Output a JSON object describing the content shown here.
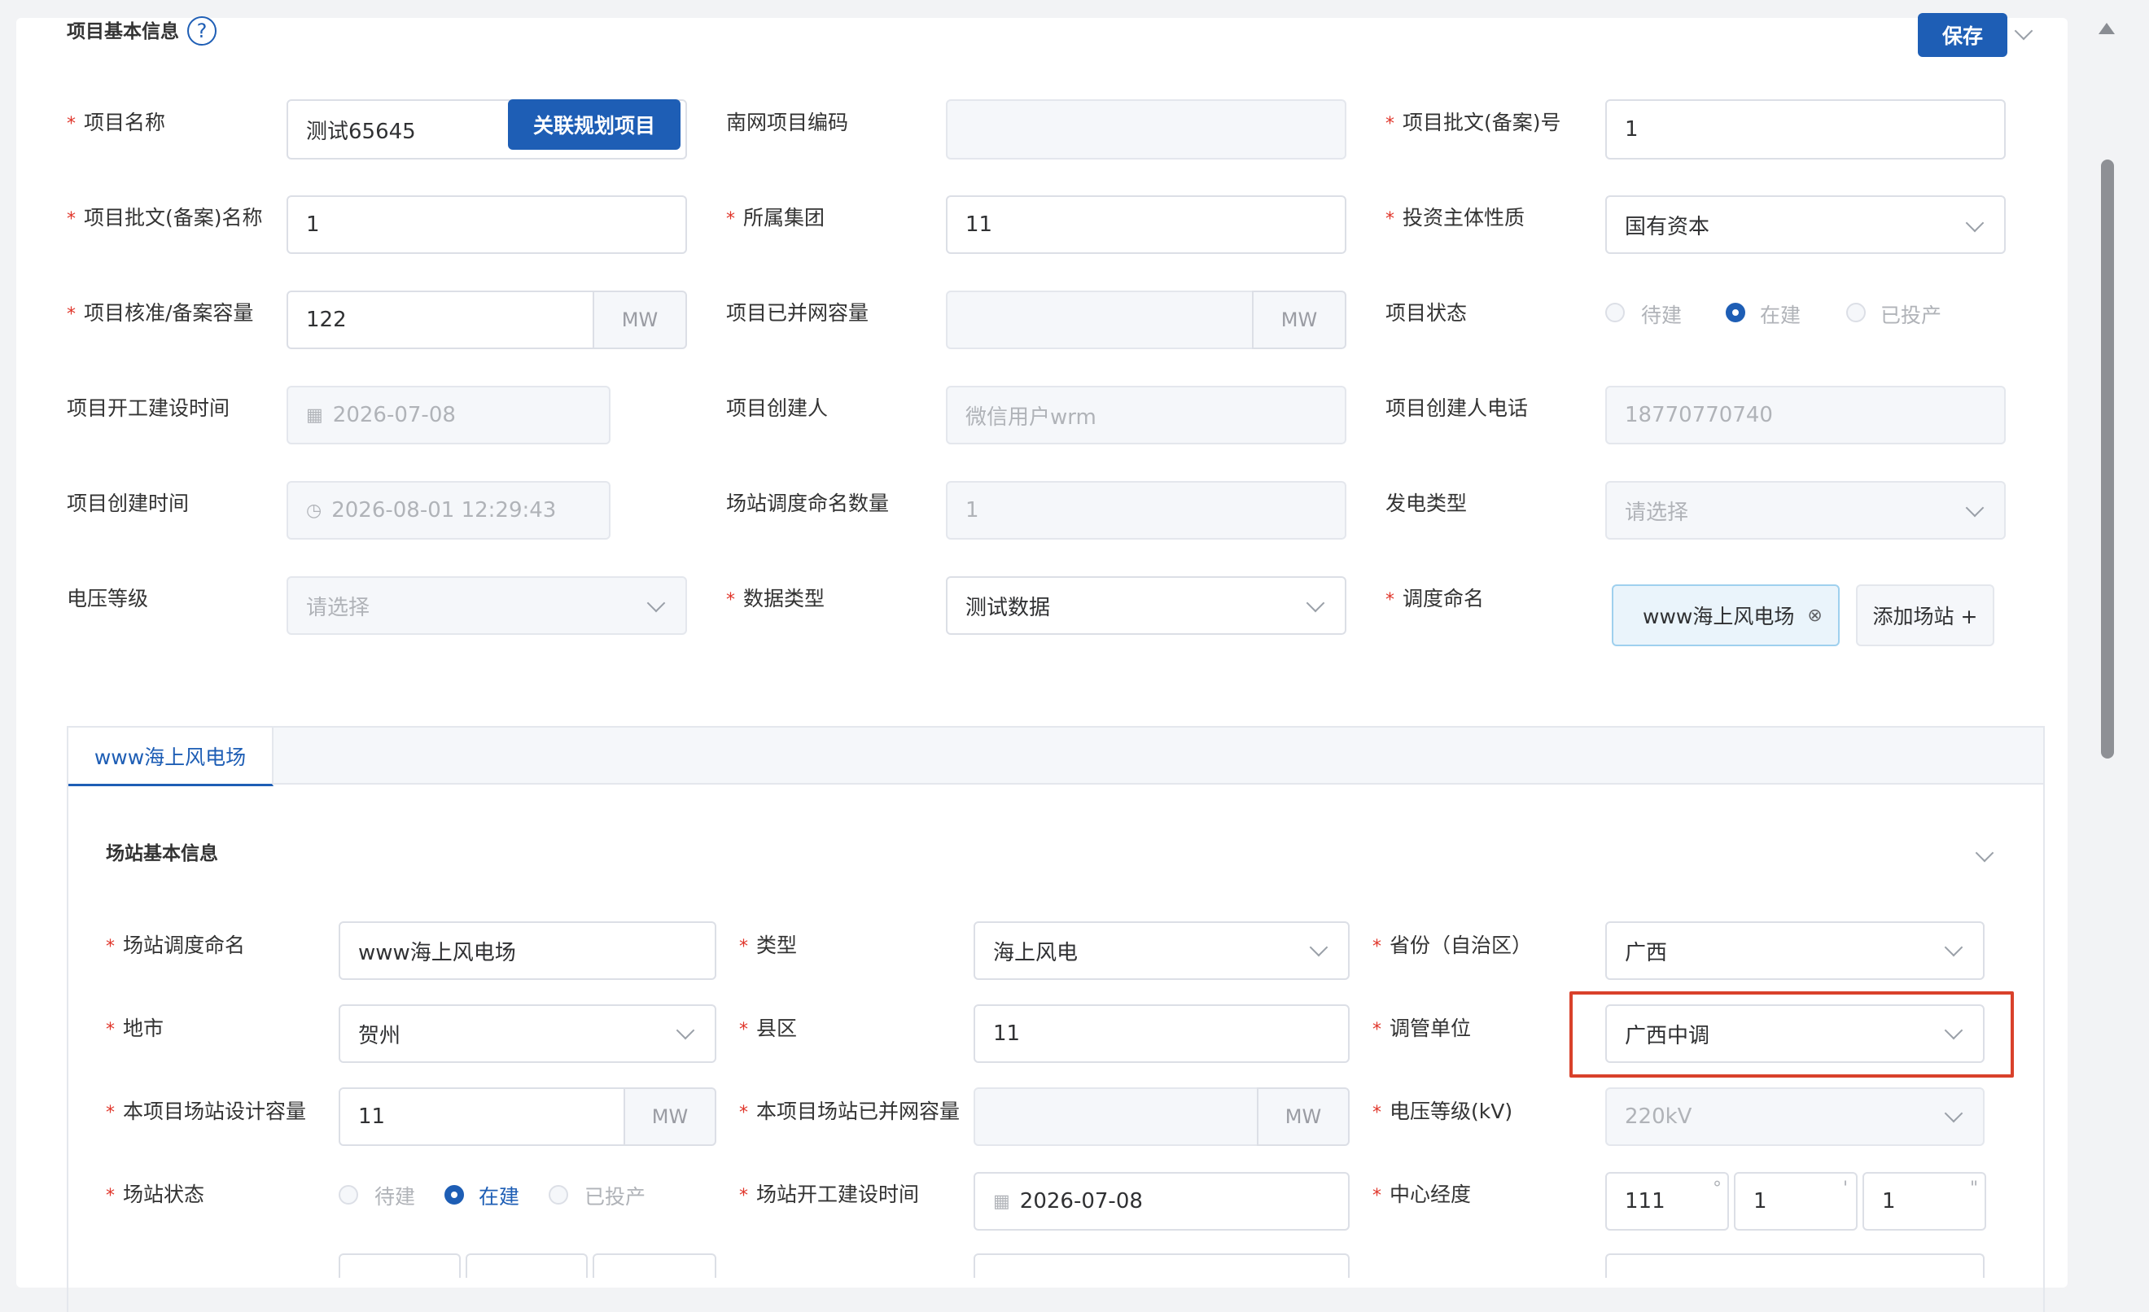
{
  "header": {
    "section_title": "项目基本信息",
    "save_label": "保存"
  },
  "project": {
    "name_label": "项目名称",
    "name_value": "测试65645",
    "link_button": "关联规划项目",
    "nanwang_code_label": "南网项目编码",
    "nanwang_code_value": "",
    "approval_no_label": "项目批文(备案)号",
    "approval_no_value": "1",
    "approval_name_label": "项目批文(备案)名称",
    "approval_name_value": "1",
    "group_label": "所属集团",
    "group_value": "11",
    "invest_label": "投资主体性质",
    "invest_value": "国有资本",
    "capacity_label": "项目核准/备案容量",
    "capacity_value": "122",
    "capacity_unit": "MW",
    "grid_capacity_label": "项目已并网容量",
    "grid_capacity_value": "",
    "grid_capacity_unit": "MW",
    "status_label": "项目状态",
    "status_options": [
      "待建",
      "在建",
      "已投产"
    ],
    "status_selected": "在建",
    "start_time_label": "项目开工建设时间",
    "start_time_value": "2026-07-08",
    "creator_label": "项目创建人",
    "creator_value": "微信用户wrm",
    "creator_phone_label": "项目创建人电话",
    "creator_phone_value": "18770770740",
    "create_time_label": "项目创建时间",
    "create_time_value": "2026-08-01 12:29:43",
    "station_count_label": "场站调度命名数量",
    "station_count_value": "1",
    "gen_type_label": "发电类型",
    "gen_type_placeholder": "请选择",
    "voltage_label": "电压等级",
    "voltage_placeholder": "请选择",
    "data_type_label": "数据类型",
    "data_type_value": "测试数据",
    "dispatch_name_label": "调度命名",
    "dispatch_tag": "www海上风电场",
    "add_station_label": "添加场站 +"
  },
  "tabs": [
    {
      "label": "www海上风电场",
      "active": true
    }
  ],
  "station": {
    "section_title": "场站基本信息",
    "dispatch_name_label": "场站调度命名",
    "dispatch_name_value": "www海上风电场",
    "type_label": "类型",
    "type_value": "海上风电",
    "province_label": "省份（自治区）",
    "province_value": "广西",
    "city_label": "地市",
    "city_value": "贺州",
    "county_label": "县区",
    "county_value": "11",
    "control_unit_label": "调管单位",
    "control_unit_value": "广西中调",
    "design_capacity_label": "本项目场站设计容量",
    "design_capacity_value": "11",
    "design_capacity_unit": "MW",
    "grid_capacity_label": "本项目场站已并网容量",
    "grid_capacity_value": "",
    "grid_capacity_unit": "MW",
    "voltage_label": "电压等级(kV)",
    "voltage_value": "220kV",
    "status_label": "场站状态",
    "status_options": [
      "待建",
      "在建",
      "已投产"
    ],
    "status_selected": "在建",
    "start_time_label": "场站开工建设时间",
    "start_time_value": "2026-07-08",
    "longitude_label": "中心经度",
    "longitude_deg": "111",
    "longitude_min": "1",
    "longitude_sec": "1",
    "deg_mark": "°",
    "min_mark": "'",
    "sec_mark": "\""
  },
  "colors": {
    "primary": "#1e5eb5",
    "highlight_border": "#d9412b",
    "required": "#e0362b"
  }
}
